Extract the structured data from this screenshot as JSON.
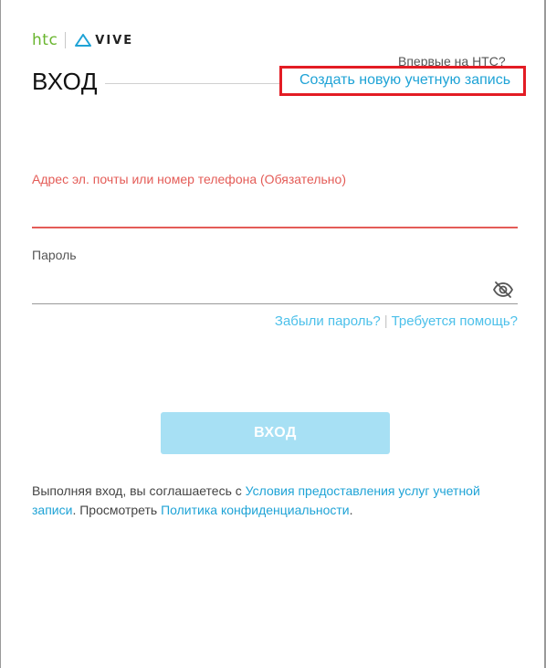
{
  "brand": {
    "htc": "htc",
    "vive": "VIVE"
  },
  "header": {
    "new_to": "Впервые на HTC?",
    "title": "ВХОД",
    "create_account": "Создать новую учетную запись"
  },
  "form": {
    "email_label": "Адрес эл. почты или номер телефона (Обязательно)",
    "email_value": "",
    "password_label": "Пароль",
    "password_value": "",
    "forgot_password": "Забыли пароль?",
    "separator": "|",
    "need_help": "Требуется помощь?",
    "login_button": "ВХОД"
  },
  "terms": {
    "prefix": "Выполняя вход, вы соглашаетесь с ",
    "terms_link": "Условия предоставления услуг учетной записи",
    "middle": ". Просмотреть ",
    "privacy_link": "Политика конфиденциальности",
    "suffix": "."
  },
  "colors": {
    "accent": "#1fa3d6",
    "link_light": "#4cc0ea",
    "error": "#e45c57",
    "highlight_box": "#e31c24",
    "button_disabled": "#a7e0f4",
    "htc_green": "#69b52e"
  },
  "icons": {
    "password_toggle": "eye-slash-icon",
    "vive_logo": "vive-logo-icon"
  }
}
